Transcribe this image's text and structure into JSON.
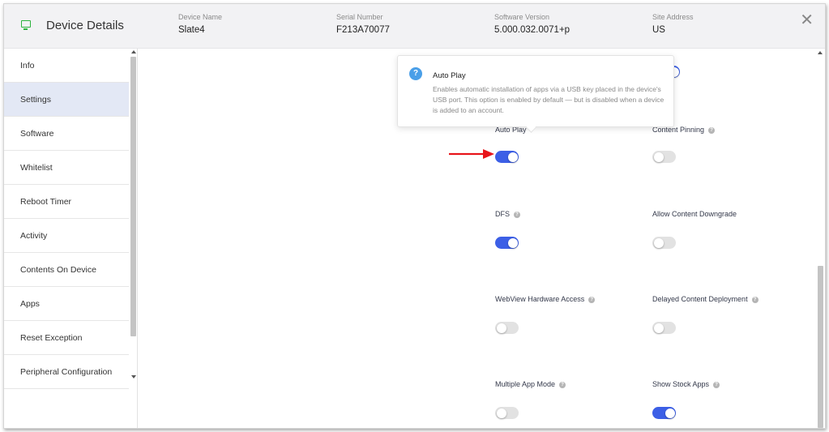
{
  "header": {
    "title": "Device Details",
    "fields": [
      {
        "label": "Device Name",
        "value": "Slate4"
      },
      {
        "label": "Serial Number",
        "value": "F213A70077"
      },
      {
        "label": "Software Version",
        "value": "5.000.032.0071+p"
      },
      {
        "label": "Site Address",
        "value": "US"
      }
    ],
    "close_icon": "close-icon"
  },
  "sidebar": {
    "items": [
      {
        "label": "Info",
        "active": false
      },
      {
        "label": "Settings",
        "active": true
      },
      {
        "label": "Software",
        "active": false
      },
      {
        "label": "Whitelist",
        "active": false
      },
      {
        "label": "Reboot Timer",
        "active": false
      },
      {
        "label": "Activity",
        "active": false
      },
      {
        "label": "Contents On Device",
        "active": false
      },
      {
        "label": "Apps",
        "active": false
      },
      {
        "label": "Reset Exception",
        "active": false
      },
      {
        "label": "Peripheral Configuration",
        "active": false
      }
    ]
  },
  "tooltip": {
    "title": "Auto Play",
    "text": "Enables automatic installation of apps via a USB key placed in the device's USB port. This option is enabled by default — but is disabled when a device is added to an account.",
    "icon": "question-icon"
  },
  "settings": [
    {
      "label": "Auto Play",
      "on": true,
      "help": true
    },
    {
      "label": "Content Pinning",
      "on": false,
      "help": true
    },
    {
      "label": "DFS",
      "on": true,
      "help": true
    },
    {
      "label": "Allow Content Downgrade",
      "on": false,
      "help": false
    },
    {
      "label": "WebView Hardware Access",
      "on": false,
      "help": true
    },
    {
      "label": "Delayed Content Deployment",
      "on": false,
      "help": true
    },
    {
      "label": "Multiple App Mode",
      "on": false,
      "help": true
    },
    {
      "label": "Show Stock Apps",
      "on": true,
      "help": true
    }
  ],
  "colors": {
    "toggle_on": "#3c5fe6",
    "toggle_off": "#e2e2e2",
    "active_nav": "#e3e8f5",
    "device_icon": "#2db33d",
    "annotation_arrow": "#e8151b"
  }
}
